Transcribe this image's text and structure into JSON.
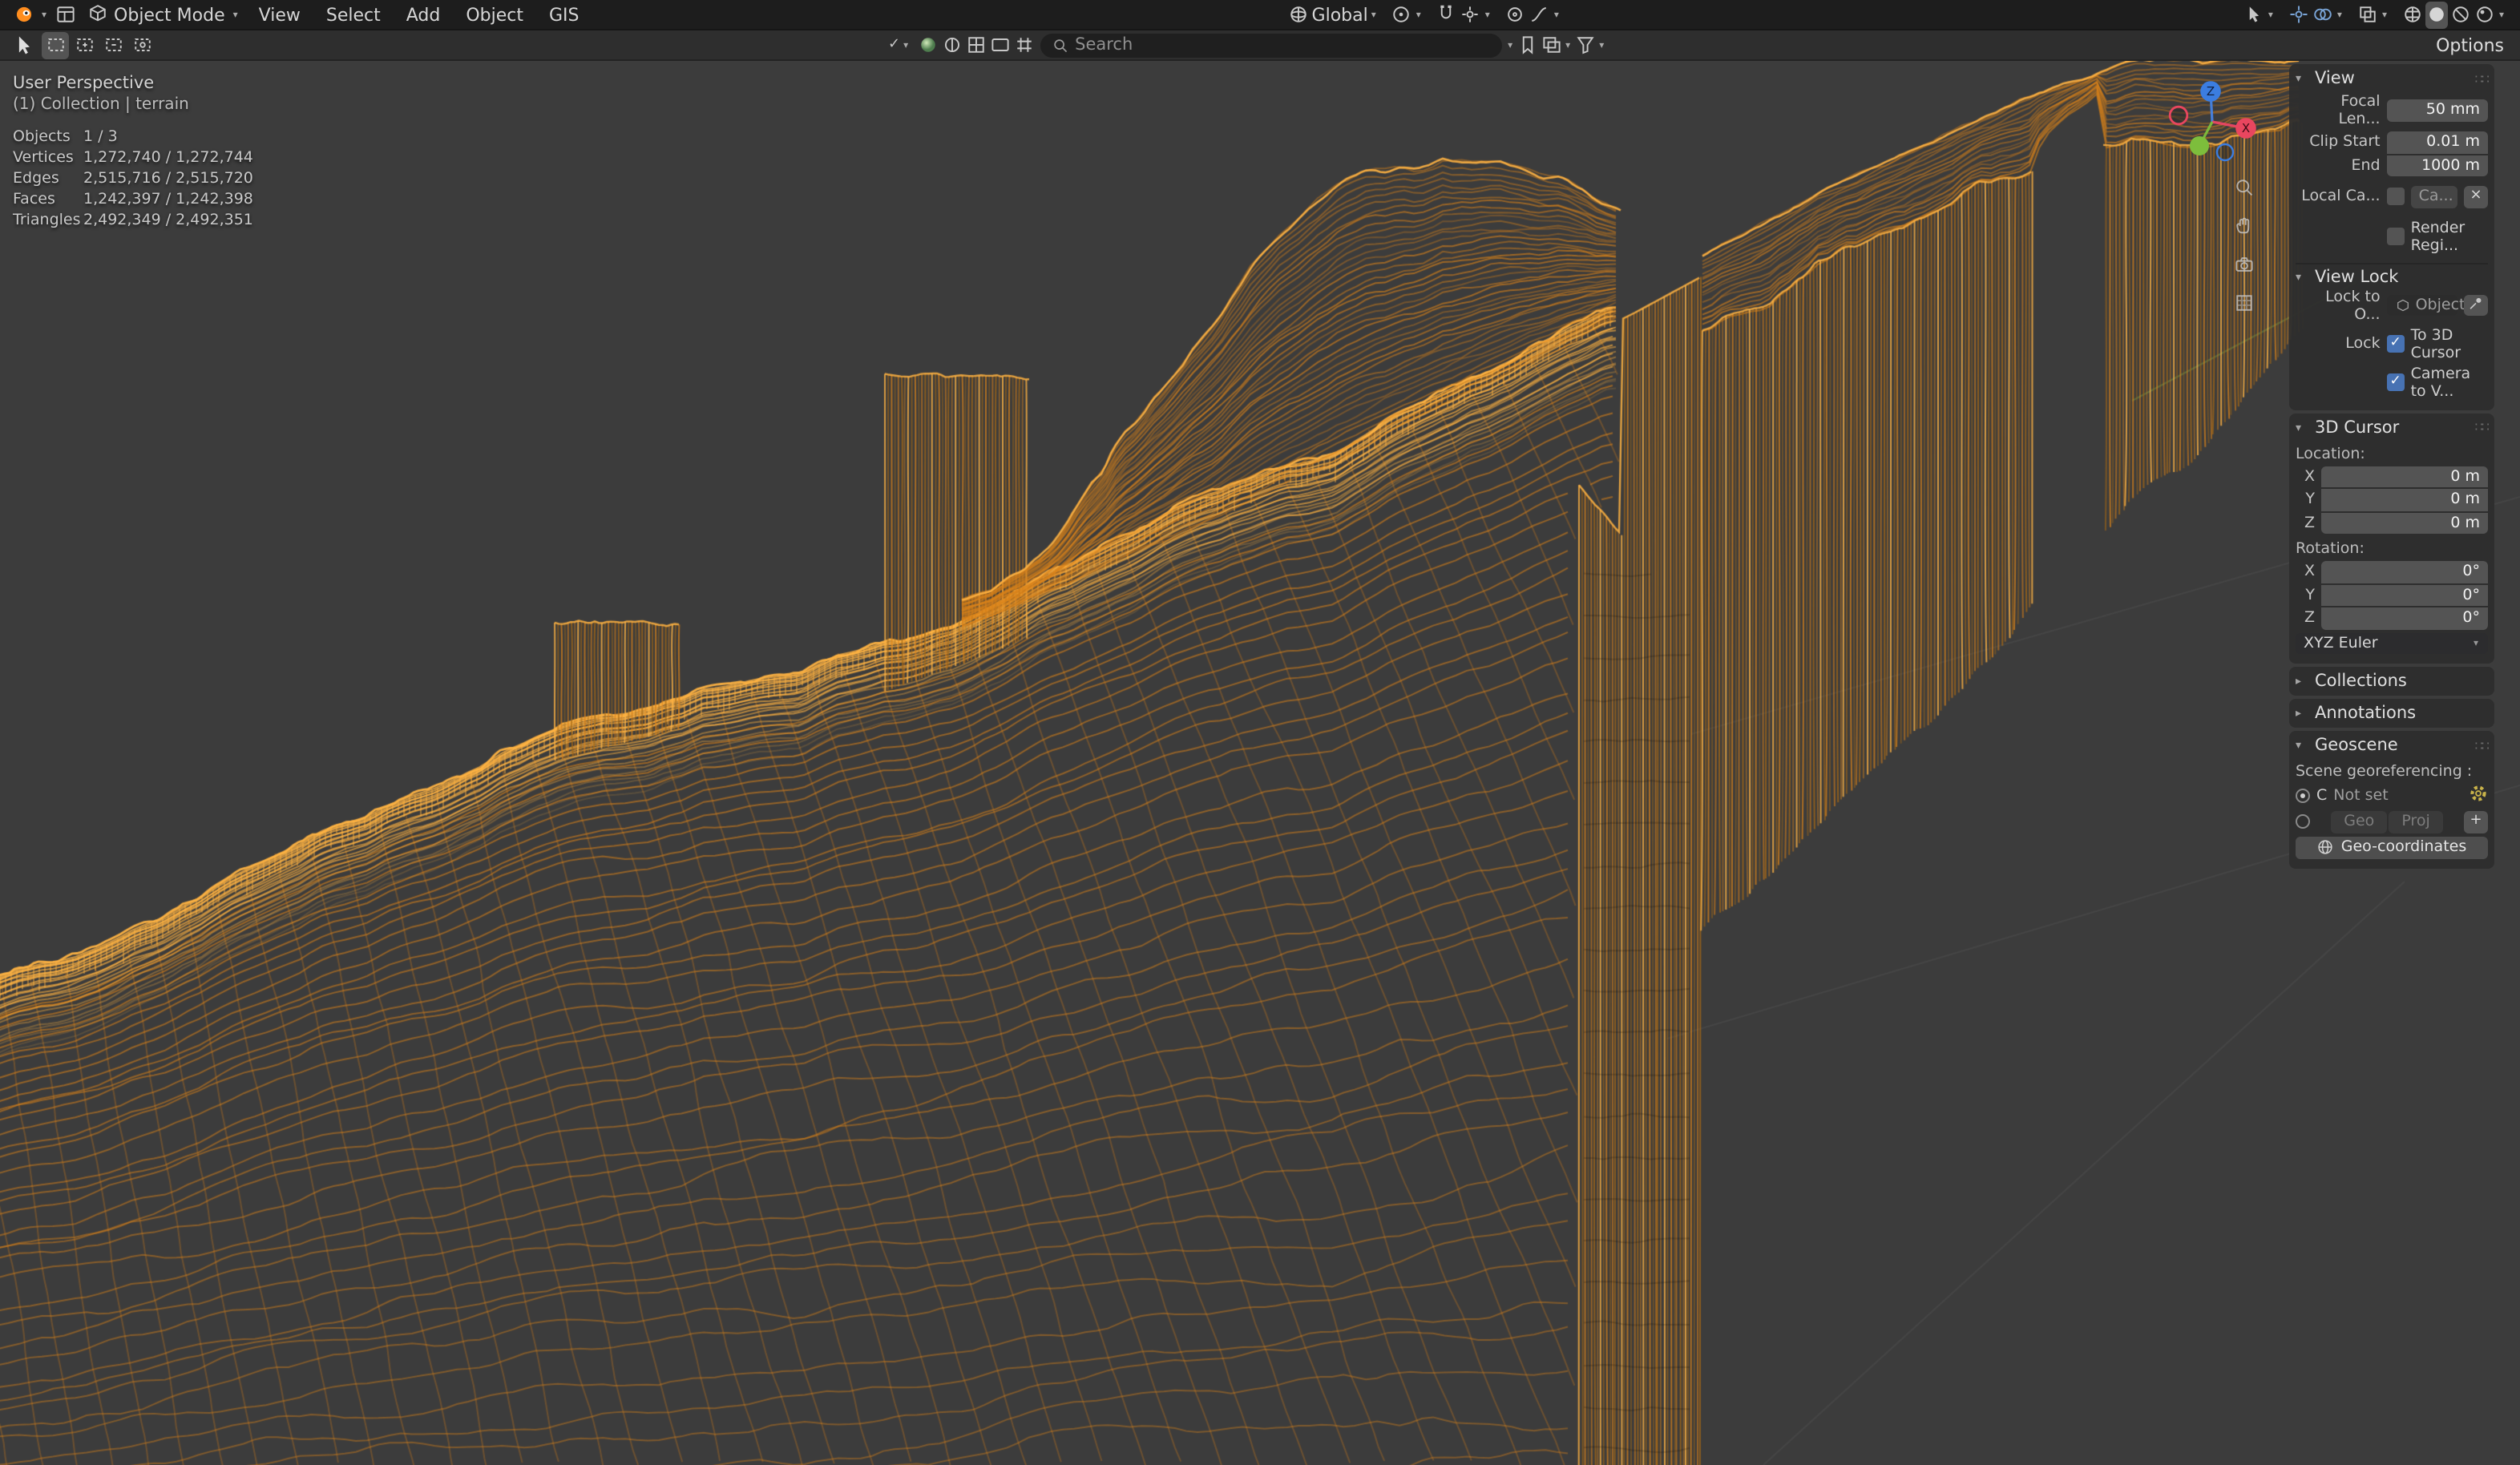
{
  "topbar": {
    "mode": "Object Mode",
    "menus": [
      "View",
      "Select",
      "Add",
      "Object",
      "GIS"
    ],
    "orientation": "Global"
  },
  "tool": {
    "search_placeholder": "Search",
    "options_label": "Options"
  },
  "overlay": {
    "view_label": "User Perspective",
    "context_label": "(1) Collection | terrain",
    "stats": [
      {
        "label": "Objects",
        "value": "1 / 3"
      },
      {
        "label": "Vertices",
        "value": "1,272,740 / 1,272,744"
      },
      {
        "label": "Edges",
        "value": "2,515,716 / 2,515,720"
      },
      {
        "label": "Faces",
        "value": "1,242,397 / 1,242,398"
      },
      {
        "label": "Triangles",
        "value": "2,492,349 / 2,492,351"
      }
    ]
  },
  "sidebar": {
    "view": {
      "title": "View",
      "focal_label": "Focal Len...",
      "focal_value": "50 mm",
      "clip_start_label": "Clip Start",
      "clip_start_value": "0.01 m",
      "clip_end_label": "End",
      "clip_end_value": "1000 m",
      "local_camera_label": "Local Ca...",
      "local_camera_value": "Ca...",
      "render_region_label": "Render Regi..."
    },
    "view_lock": {
      "title": "View Lock",
      "lock_to_label": "Lock to O...",
      "object_placeholder": "Object",
      "lock_label": "Lock",
      "to_cursor_label": "To 3D Cursor",
      "camera_label": "Camera to V..."
    },
    "cursor": {
      "title": "3D Cursor",
      "location_label": "Location:",
      "rotation_label": "Rotation:",
      "axes": [
        "X",
        "Y",
        "Z"
      ],
      "location_values": [
        "0 m",
        "0 m",
        "0 m"
      ],
      "rotation_values": [
        "0°",
        "0°",
        "0°"
      ],
      "euler": "XYZ Euler"
    },
    "collections_title": "Collections",
    "annotations_title": "Annotations",
    "geoscene": {
      "title": "Geoscene",
      "georef_label": "Scene georeferencing :",
      "crs_code": "C",
      "crs_status": "Not set",
      "geo_label": "Geo",
      "proj_label": "Proj",
      "coords_button": "Geo-coordinates"
    }
  },
  "gizmo": {
    "x_label": "X",
    "z_label": "Z"
  },
  "icons": {
    "caret_down": "▾",
    "caret_right": "▸",
    "check": "✓",
    "close": "×",
    "plus": "+",
    "grip": "∷∷"
  },
  "colors": {
    "viewport_bg": "#3c3c3c",
    "header_bg": "#1d1d1d",
    "accent_blue": "#4772b3",
    "wire": "#d9821a",
    "wire_bright": "#ffb342",
    "wire_dark": "#a96a14"
  }
}
